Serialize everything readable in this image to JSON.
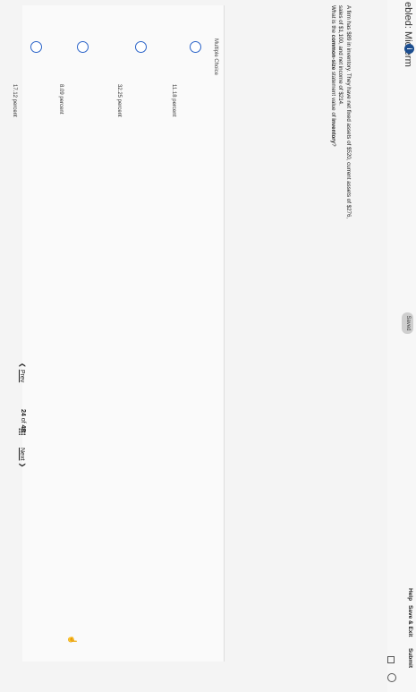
{
  "header": {
    "title": "ebled: Midterm",
    "info_icon": "info-icon",
    "saved_label": "Saved",
    "help_label": "Help",
    "save_exit_label": "Save & Exit",
    "submit_label": "Submit"
  },
  "question": {
    "line1": "A firm has $89 in inventory. They have net fixed assets of $520, current assets of $276,",
    "line2": "sales of $1,100, and net income of $214.",
    "line3_prefix": "What is the ",
    "line3_bold1": "common-size",
    "line3_mid": " statement value of ",
    "line3_bold2": "inventory",
    "line3_suffix": "?"
  },
  "answers": {
    "label": "Multiple Choice",
    "options": [
      "11.18 percent",
      "32.25 percent",
      "8.09 percent",
      "17.12 percent"
    ]
  },
  "nav": {
    "prev_label": "Prev",
    "current": "24",
    "of_label": "of",
    "total": "48",
    "next_label": "Next"
  },
  "colors": {
    "accent": "#2a63c8",
    "info_badge": "#1d4e8f"
  }
}
